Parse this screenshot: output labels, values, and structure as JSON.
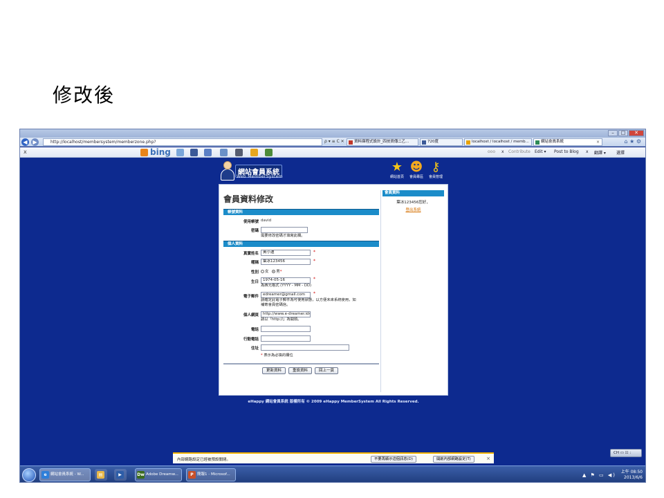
{
  "slide": {
    "title": "修改後"
  },
  "browser": {
    "window_buttons": [
      "–",
      "□",
      "✕"
    ],
    "url": "http://localhost/membersystem/memberzone.php?",
    "addr_tools": "ρ ▾ ≡ C ✕",
    "tabs": [
      {
        "label": "資料庫程式設計_四技資傳二乙...",
        "fav_color": "#c0392b",
        "active": false
      },
      {
        "label": "720度",
        "fav_color": "#3b5998",
        "active": false
      },
      {
        "label": "localhost / localhost / memb...",
        "fav_color": "#e8a200",
        "active": false
      },
      {
        "label": "網站會員系統",
        "fav_color": "#2e8b57",
        "active": true
      }
    ],
    "home_icons": "⌂ ★ ⚙",
    "toolbar": {
      "close_glyph": "x",
      "bing": "bing",
      "bing_icons": [
        {
          "name": "cloud-icon",
          "color": "#7aa6d9"
        },
        {
          "name": "facebook-icon",
          "color": "#3b5998"
        },
        {
          "name": "thumb-up-icon",
          "color": "#5b7fc5"
        },
        {
          "name": "chat-icon",
          "color": "#6a90c8"
        },
        {
          "name": "glasses-icon",
          "color": "#555c70"
        },
        {
          "name": "sparkle-icon",
          "color": "#e6a61e"
        },
        {
          "name": "gear-group-icon",
          "color": "#4d8b3a"
        }
      ],
      "right_pre": "ooo",
      "contribute_x": "x",
      "contribute": "Contribute",
      "edit": "Edit ▾",
      "post_to_blog": "Post to Blog",
      "x2": "x",
      "translate": "翻譯 ▾",
      "extra": "選擇"
    }
  },
  "site": {
    "logo_title": "網站會員系統",
    "logo_sub": "Web MemberSystem",
    "nav": [
      {
        "glyph": "★",
        "label": "網站首頁",
        "color": "#f5c518"
      },
      {
        "glyph": "☻",
        "label": "會員專區",
        "color": "#f3a91f"
      },
      {
        "glyph": "⚷",
        "label": "會員管理",
        "color": "#f5c518"
      }
    ],
    "side": {
      "heading": "會員資料",
      "greeting": "葉冰123456您好，",
      "logout": "登出系統"
    },
    "form": {
      "title": "會員資料修改",
      "section_account": "帳號資料",
      "username_label": "使用帳號",
      "username_value": "david",
      "password_label": "密碼",
      "password_value": "",
      "password_hint": "需要修改密碼才填寫此欄。",
      "section_personal": "個人資料",
      "realname_label": "真實姓名",
      "realname_value": "黃小迪",
      "nickname_label": "暱稱",
      "nickname_value": "葉冰123456",
      "gender_label": "性別",
      "gender_female": "女",
      "gender_male": "男",
      "gender_selected": "男",
      "birthday_label": "生日",
      "birthday_value": "1974-05-16",
      "birthday_hint": "為西元格式 (YYYY - MM - DD)",
      "email_label": "電子郵件",
      "email_value": "edreamer@gmail.com",
      "email_hint_1": "請確定此電子郵件為可使用狀態，以方便未來系統使用，如",
      "email_hint_2": "補寄會員密碼信。",
      "homepage_label": "個人網頁",
      "homepage_value": "http://www.e-dreamer.idv",
      "homepage_hint": "請以「http://」為開頭。",
      "phone_label": "電話",
      "phone_value": "",
      "mobile_label": "行動電話",
      "mobile_value": "",
      "address_label": "住址",
      "address_value": "",
      "required_mark": "*",
      "required_note": "表示為必填的欄位",
      "btn_update": "更新資料",
      "btn_reset": "重設資料",
      "btn_back": "回上一頁"
    },
    "footer": "eHappy 網站會員系統 版權所有 © 2009 eHappy MemberSystem All Rights Reserved."
  },
  "notification": {
    "text": "內部網路設定已經被預設關閉。",
    "btn_dismiss": "不要再顯示這個訊息(D)",
    "btn_enable": "開啟內部網路設定(T)",
    "close": "×"
  },
  "taskbar": {
    "items": [
      {
        "label": "網站會員系統 - W...",
        "ico": "e",
        "color": "#2f7fd9"
      },
      {
        "label": "",
        "ico": "▤",
        "color": "#e8b84a"
      },
      {
        "label": "",
        "ico": "▶",
        "color": "#2d5da8"
      },
      {
        "label": "Adobe Dreamw...",
        "ico": "Dw",
        "color": "#3a6b1f"
      },
      {
        "label": "簡報1 - Microsof...",
        "ico": "P",
        "color": "#c8502a"
      }
    ],
    "lang": "CH ▭ ☷ :",
    "tray_icons": "▲ ⚑ ▭ ◀)",
    "time": "上午 08:50",
    "date": "2013/6/6"
  }
}
